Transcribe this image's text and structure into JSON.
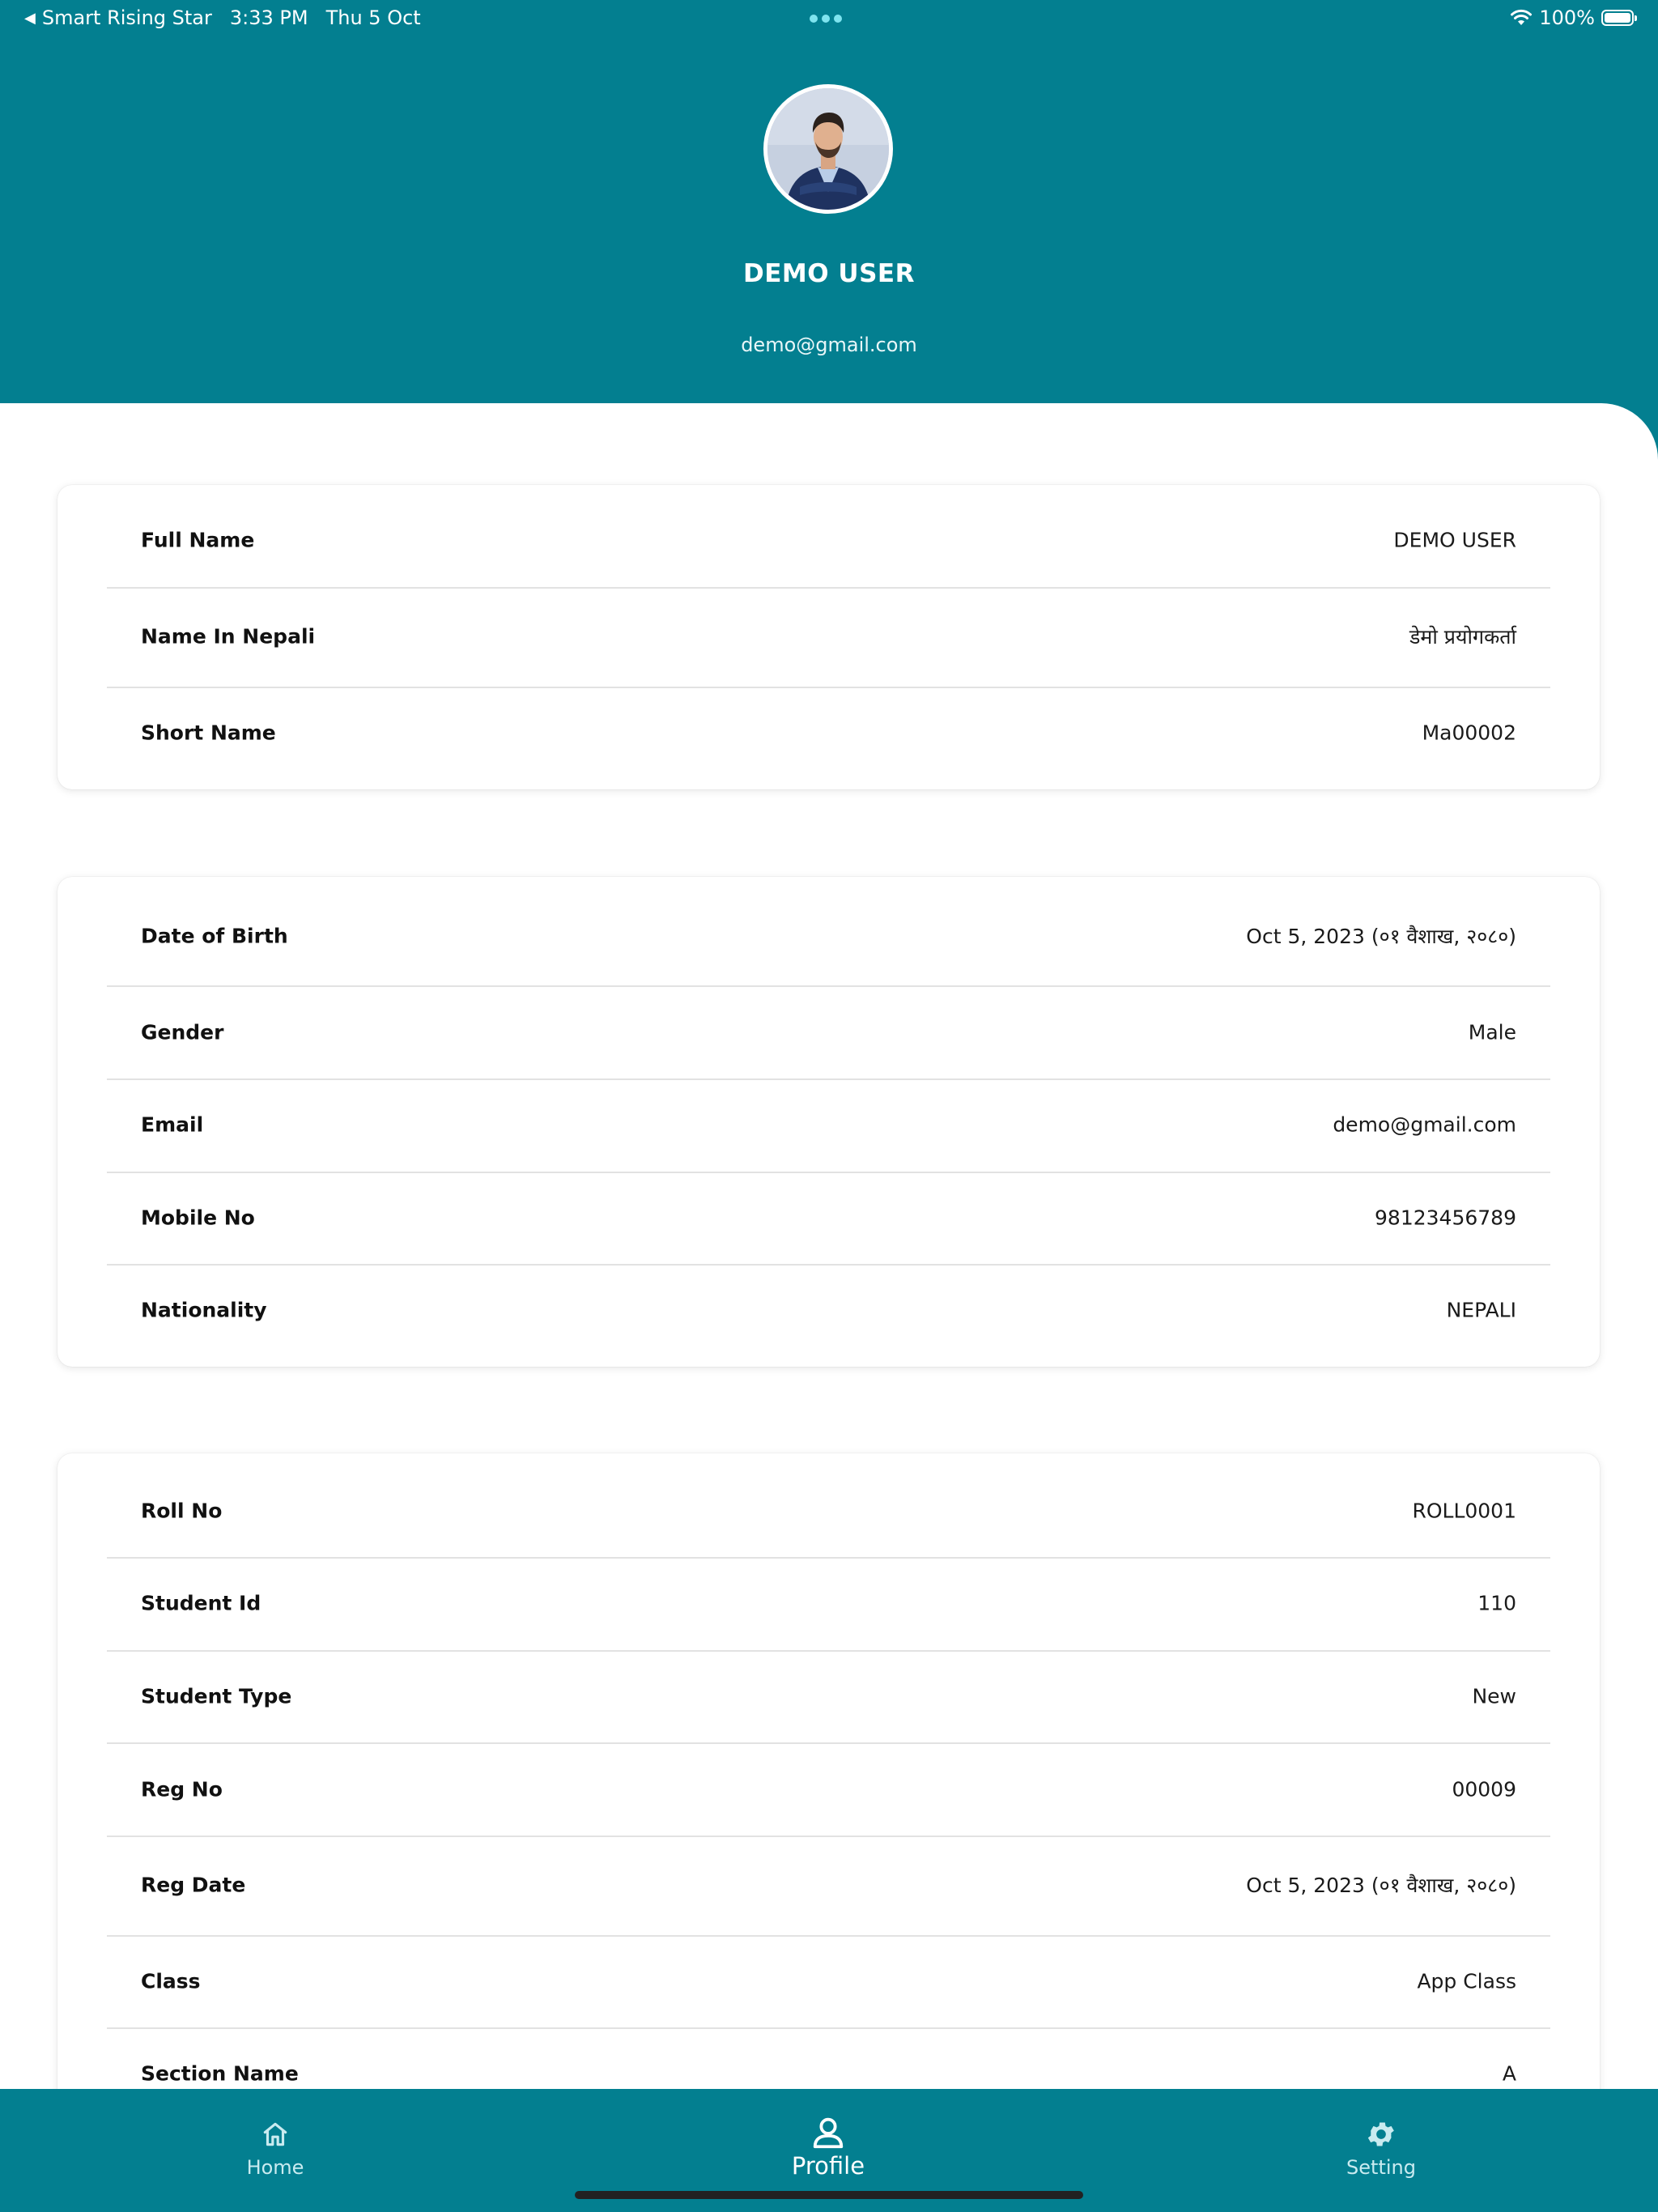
{
  "status_bar": {
    "back_app": "Smart Rising Star",
    "time": "3:33 PM",
    "date": "Thu 5 Oct",
    "battery": "100%"
  },
  "profile": {
    "name": "DEMO USER",
    "email": "demo@gmail.com"
  },
  "sections": [
    {
      "rows": [
        {
          "label": "Full Name",
          "value": "DEMO USER"
        },
        {
          "label": "Name In Nepali",
          "value": "डेमो प्रयोगकर्ता"
        },
        {
          "label": "Short Name",
          "value": "Ma00002"
        }
      ]
    },
    {
      "rows": [
        {
          "label": "Date of Birth",
          "value": "Oct 5, 2023 (०१ वैशाख, २०८०)"
        },
        {
          "label": "Gender",
          "value": "Male"
        },
        {
          "label": "Email",
          "value": "demo@gmail.com"
        },
        {
          "label": "Mobile No",
          "value": "98123456789"
        },
        {
          "label": "Nationality",
          "value": "NEPALI"
        }
      ]
    },
    {
      "rows": [
        {
          "label": "Roll No",
          "value": "ROLL0001"
        },
        {
          "label": "Student Id",
          "value": "110"
        },
        {
          "label": "Student Type",
          "value": "New"
        },
        {
          "label": "Reg No",
          "value": "00009"
        },
        {
          "label": "Reg Date",
          "value": "Oct 5, 2023 (०१ वैशाख, २०८०)"
        },
        {
          "label": "Class",
          "value": "App Class"
        },
        {
          "label": "Section Name",
          "value": "A"
        }
      ]
    }
  ],
  "bottom_nav": {
    "home": {
      "label": "Home",
      "icon": "home-icon"
    },
    "profile": {
      "label": "Profile",
      "icon": "user-icon",
      "active": true
    },
    "setting": {
      "label": "Setting",
      "icon": "gear-icon"
    }
  },
  "colors": {
    "primary": "#037f90",
    "inactive_nav": "#c9ebf0",
    "active_nav": "#ffffff"
  }
}
